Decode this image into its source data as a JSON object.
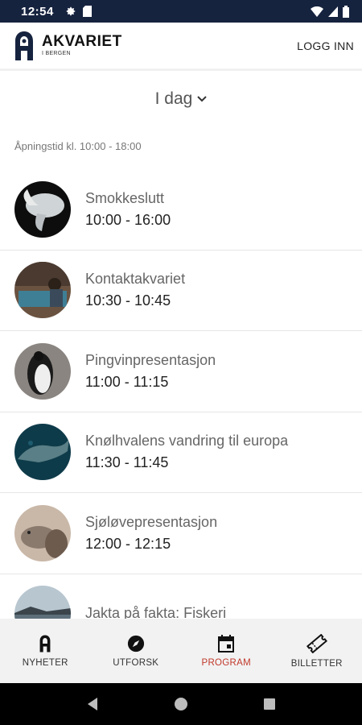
{
  "status_bar": {
    "time": "12:54"
  },
  "header": {
    "logo_title": "AKVARIET",
    "logo_subtitle": "I BERGEN",
    "login_label": "LOGG INN"
  },
  "day_selector": {
    "label": "I dag"
  },
  "opening_hours": "Åpningstid kl. 10:00 - 18:00",
  "program": [
    {
      "title": "Smokkeslutt",
      "time": "10:00 - 16:00"
    },
    {
      "title": "Kontaktakvariet",
      "time": "10:30 - 10:45"
    },
    {
      "title": "Pingvinpresentasjon",
      "time": "11:00 - 11:15"
    },
    {
      "title": "Knølhvalens vandring til europa",
      "time": "11:30 - 11:45"
    },
    {
      "title": "Sjøløvepresentasjon",
      "time": "12:00 - 12:15"
    },
    {
      "title": "Jakta på fakta: Fiskeri",
      "time": ""
    }
  ],
  "bottom_nav": {
    "tabs": [
      {
        "label": "NYHETER",
        "icon": "akvariet-logo-icon"
      },
      {
        "label": "UTFORSK",
        "icon": "compass-icon"
      },
      {
        "label": "PROGRAM",
        "icon": "calendar-icon"
      },
      {
        "label": "BILLETTER",
        "icon": "ticket-icon"
      }
    ],
    "active": "PROGRAM"
  },
  "colors": {
    "status_bar": "#16233f",
    "accent": "#c0392b",
    "nav_background": "#f2f2f2"
  }
}
